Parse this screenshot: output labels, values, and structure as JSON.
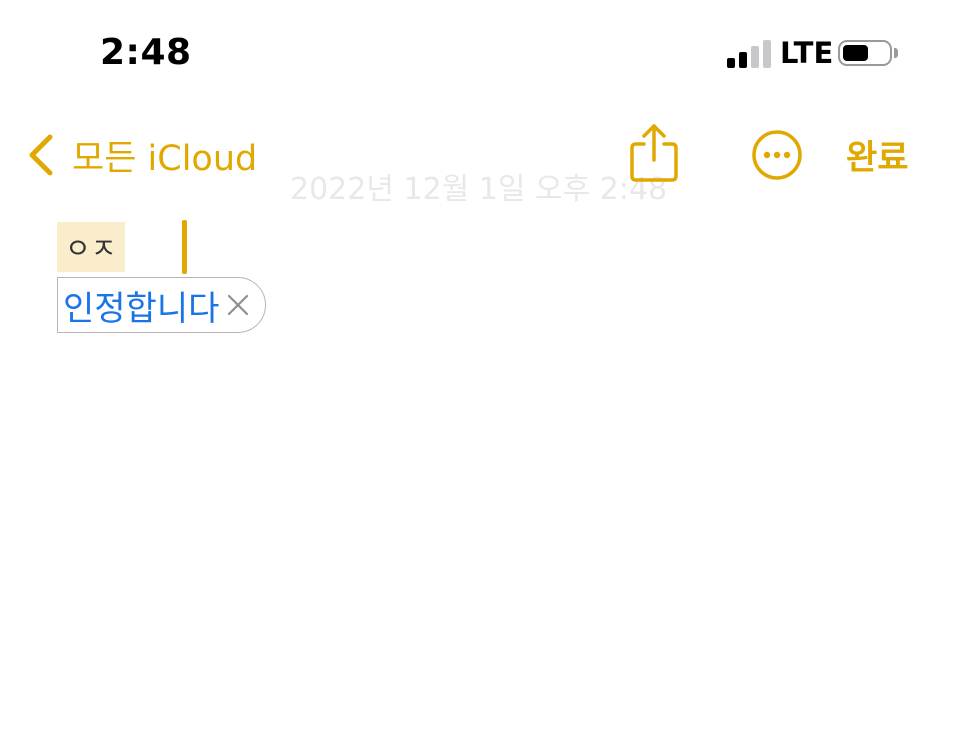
{
  "status_bar": {
    "time": "2:48",
    "network": "LTE",
    "signal_bars": 4,
    "signal_active": 2,
    "battery_level": 0.55
  },
  "nav": {
    "back_label": "모든 iCloud",
    "done_label": "완료",
    "faded_date": "2022년 12월 1일 오후 2:48",
    "back_icon": "chevron-left-icon",
    "share_icon": "share-icon",
    "more_icon": "ellipsis-circle-icon"
  },
  "note": {
    "marked_text": "ㅇㅈ",
    "suggestion": "인정합니다",
    "dismiss_icon": "close-icon"
  },
  "colors": {
    "accent": "#e0a800",
    "suggestion_text": "#1a74e8",
    "marked_highlight": "#faedcc"
  }
}
